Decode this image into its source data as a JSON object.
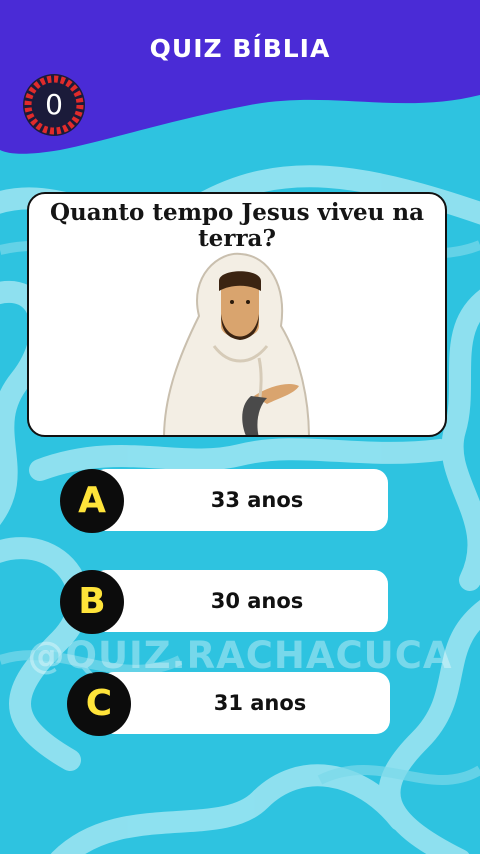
{
  "header": {
    "title": "QUIZ BÍBLIA"
  },
  "timer": {
    "value": "0"
  },
  "question": {
    "text": "Quanto tempo Jesus viveu na terra?"
  },
  "options": [
    {
      "letter": "A",
      "text": "33 anos"
    },
    {
      "letter": "B",
      "text": "30 anos"
    },
    {
      "letter": "C",
      "text": "31 anos"
    }
  ],
  "watermark": "@QUIZ.RACHACUCA",
  "colors": {
    "header_purple": "#4a2bd6",
    "background_cyan": "#2ec3e0",
    "badge_yellow": "#ffe43a",
    "timer_red": "#e02b2b"
  }
}
